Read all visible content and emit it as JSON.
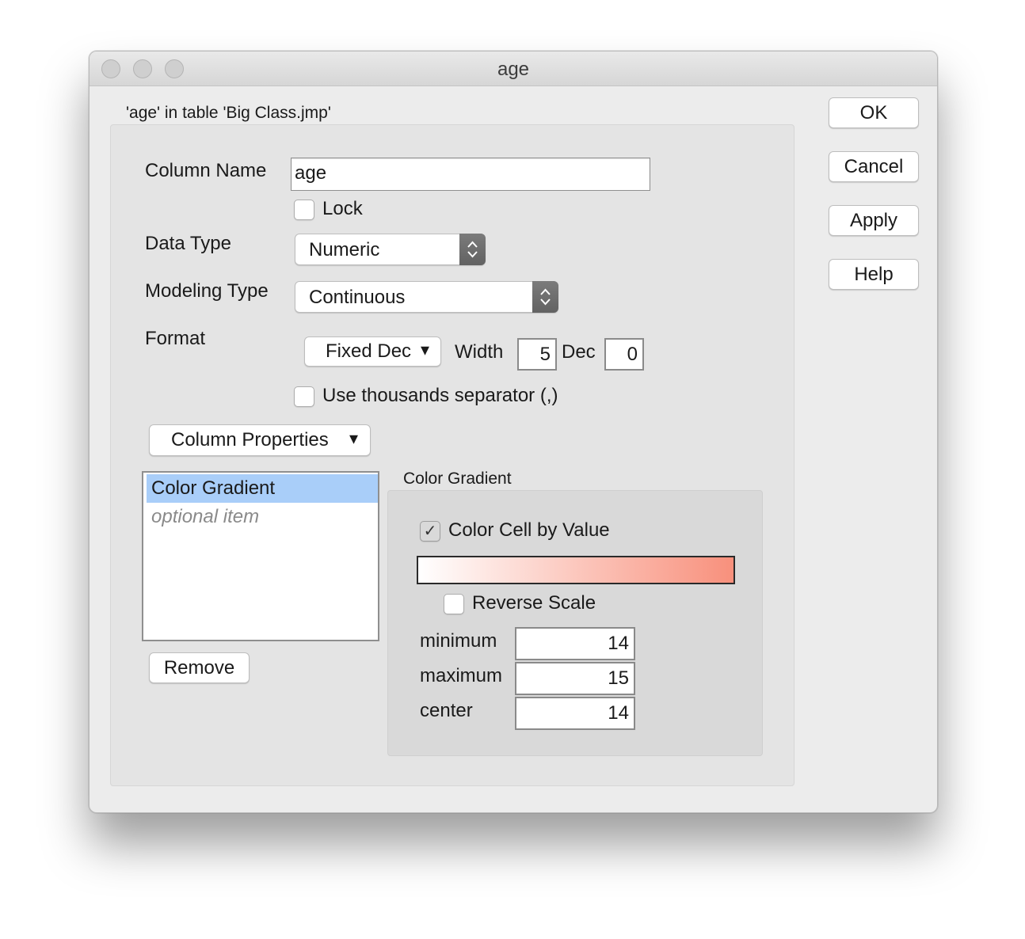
{
  "window": {
    "title": "age",
    "subtitle": "'age' in table 'Big Class.jmp'"
  },
  "buttons": {
    "ok": "OK",
    "cancel": "Cancel",
    "apply": "Apply",
    "help": "Help"
  },
  "form": {
    "column_name_label": "Column Name",
    "column_name_value": "age",
    "lock_label": "Lock",
    "lock_checked": false,
    "data_type_label": "Data Type",
    "data_type_value": "Numeric",
    "modeling_type_label": "Modeling Type",
    "modeling_type_value": "Continuous",
    "format_label": "Format",
    "format_value": "Fixed Dec",
    "width_label": "Width",
    "width_value": "5",
    "dec_label": "Dec",
    "dec_value": "0",
    "thousands_label": "Use thousands separator (,)",
    "thousands_checked": false
  },
  "column_properties": {
    "menu_label": "Column Properties",
    "items": [
      {
        "label": "Color Gradient",
        "selected": true
      },
      {
        "label": "optional item",
        "selected": false
      }
    ],
    "remove_label": "Remove"
  },
  "color_gradient": {
    "group_title": "Color Gradient",
    "color_cell_label": "Color Cell by Value",
    "color_cell_checked": true,
    "reverse_label": "Reverse Scale",
    "reverse_checked": false,
    "gradient_start": "#ffffff",
    "gradient_end": "#f8907c",
    "minimum_label": "minimum",
    "minimum_value": "14",
    "maximum_label": "maximum",
    "maximum_value": "15",
    "center_label": "center",
    "center_value": "14"
  },
  "icons": {
    "check": "✓",
    "dropdown": "▾"
  }
}
